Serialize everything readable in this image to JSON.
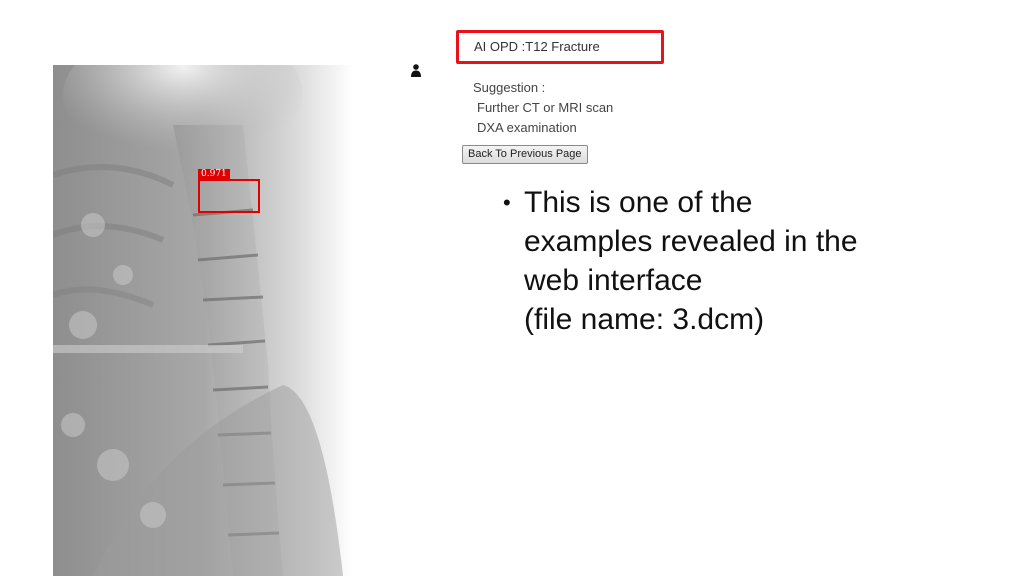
{
  "result": {
    "text": "AI OPD :T12 Fracture"
  },
  "suggestion": {
    "heading": "Suggestion :",
    "items": [
      "Further CT or MRI scan",
      "DXA examination"
    ]
  },
  "back_button": {
    "label": "Back To Previous Page"
  },
  "detection": {
    "score": "0.971",
    "color": "#e00000"
  },
  "bullet": {
    "lines": [
      "This is one of the",
      "examples revealed in the",
      "web interface",
      "(file name: 3.dcm)"
    ]
  },
  "icons": {
    "user": "user-icon",
    "bullet": "bullet-dot"
  }
}
